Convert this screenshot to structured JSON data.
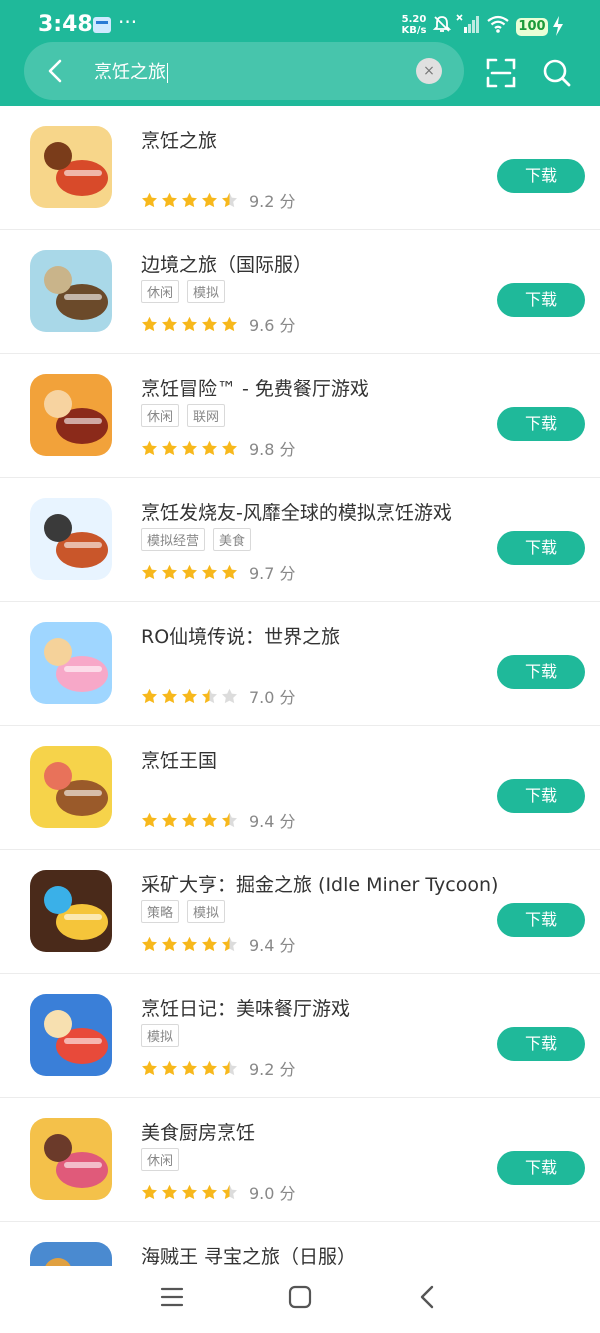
{
  "status_bar": {
    "time": "3:48",
    "dots": "···",
    "net_speed": "5.20",
    "net_unit": "KB/s",
    "battery": "100"
  },
  "search": {
    "query": "烹饪之旅",
    "clear_symbol": "×"
  },
  "download_label": "下载",
  "score_unit": "分",
  "apps": [
    {
      "name": "烹饪之旅",
      "tags": [],
      "rating": 4.5,
      "score": "9.2",
      "colors": [
        "#f7d68a",
        "#d84a2a",
        "#7a3c1a"
      ]
    },
    {
      "name": "边境之旅（国际服）",
      "tags": [
        "休闲",
        "模拟"
      ],
      "rating": 5,
      "score": "9.6",
      "colors": [
        "#a9d8e8",
        "#6b4a2a",
        "#c9b48a"
      ]
    },
    {
      "name": "烹饪冒险™ - 免费餐厅游戏",
      "tags": [
        "休闲",
        "联网"
      ],
      "rating": 5,
      "score": "9.8",
      "colors": [
        "#f2a23a",
        "#8b2a1a",
        "#f7d3a0"
      ]
    },
    {
      "name": "烹饪发烧友-风靡全球的模拟烹饪游戏",
      "tags": [
        "模拟经营",
        "美食"
      ],
      "rating": 5,
      "score": "9.7",
      "colors": [
        "#e8f4ff",
        "#c9562a",
        "#3a3a3a"
      ]
    },
    {
      "name": "RO仙境传说：世界之旅",
      "tags": [],
      "rating": 3.5,
      "score": "7.0",
      "colors": [
        "#9fd6ff",
        "#f7a8c8",
        "#f5d29a"
      ]
    },
    {
      "name": "烹饪王国",
      "tags": [],
      "rating": 4.5,
      "score": "9.4",
      "colors": [
        "#f6d34a",
        "#9a5a2a",
        "#e8725a"
      ]
    },
    {
      "name": "采矿大亨：掘金之旅 (Idle Miner Tycoon)",
      "tags": [
        "策略",
        "模拟"
      ],
      "rating": 4.5,
      "score": "9.4",
      "colors": [
        "#4a2a1a",
        "#f5c53a",
        "#3ab0e8"
      ]
    },
    {
      "name": "烹饪日记：美味餐厅游戏",
      "tags": [
        "模拟"
      ],
      "rating": 4.5,
      "score": "9.2",
      "colors": [
        "#3a7fd8",
        "#e84a3a",
        "#f7e0b0"
      ]
    },
    {
      "name": "美食厨房烹饪",
      "tags": [
        "休闲"
      ],
      "rating": 4.5,
      "score": "9.0",
      "colors": [
        "#f4c14a",
        "#e05a7a",
        "#6b3a2a"
      ]
    },
    {
      "name": "海贼王 寻宝之旅（日服）",
      "tags": [],
      "rating": 0,
      "score": "",
      "colors": [
        "#4a8ad0",
        "#f0d070",
        "#e0a040"
      ]
    }
  ],
  "icons": {
    "back": "chevron-left-icon",
    "scan": "scan-icon",
    "search": "search-icon",
    "nav_menu": "menu-icon",
    "nav_home": "home-icon",
    "nav_back": "back-icon"
  },
  "colors": {
    "accent": "#1fb99a",
    "star": "#f7b81c",
    "star_empty": "#dcdcdc"
  }
}
